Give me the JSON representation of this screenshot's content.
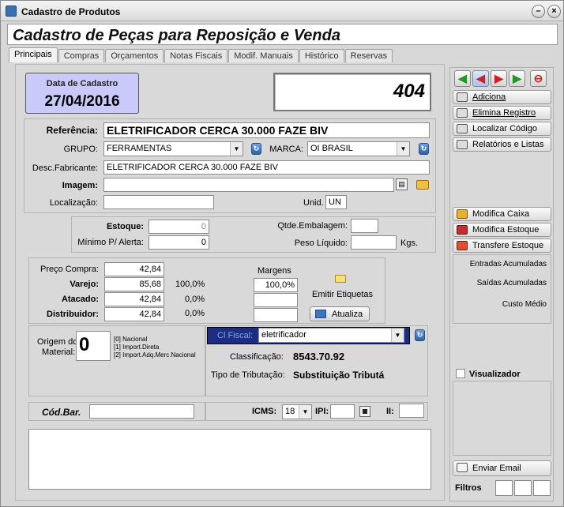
{
  "window": {
    "title": "Cadastro de Produtos"
  },
  "header": {
    "title": "Cadastro de Peças para Reposição e Venda"
  },
  "tabs": [
    "Principais",
    "Compras",
    "Orçamentos",
    "Notas Fiscais",
    "Modif. Manuais",
    "Histórico",
    "Reservas"
  ],
  "data_cadastro": {
    "label": "Data de Cadastro",
    "value": "27/04/2016"
  },
  "codigo": "404",
  "produto": {
    "referencia_label": "Referência:",
    "referencia": "ELETRIFICADOR CERCA 30.000 FAZE BIV",
    "grupo_label": "GRUPO:",
    "grupo": "FERRAMENTAS",
    "marca_label": "MARCA:",
    "marca": "OI BRASIL",
    "desc_label": "Desc.Fabricante:",
    "desc": "ELETRIFICADOR CERCA 30.000 FAZE BIV",
    "imagem_label": "Imagem:",
    "imagem": "",
    "localizacao_label": "Localização:",
    "localizacao": "",
    "unid_label": "Unid.",
    "unid": "UN"
  },
  "estoque": {
    "estoque_label": "Estoque:",
    "estoque": "0",
    "minimo_label": "Mínimo P/ Alerta:",
    "minimo": "0",
    "qtde_label": "Qtde.Embalagem:",
    "qtde": "",
    "peso_label": "Peso Líquido:",
    "peso": "",
    "peso_unit": "Kgs."
  },
  "precos": {
    "compra_label": "Preço Compra:",
    "compra": "42,84",
    "varejo_label": "Varejo:",
    "varejo": "85,68",
    "varejo_pct": "100,0%",
    "atacado_label": "Atacado:",
    "atacado": "42,84",
    "atacado_pct": "0,0%",
    "distrib_label": "Distribuidor:",
    "distrib": "42,84",
    "distrib_pct": "0,0%",
    "margens_label": "Margens",
    "margem1": "100,0%",
    "etiquetas_label": "Emitir Etiquetas",
    "atualiza_label": "Atualiza"
  },
  "origem": {
    "label1": "Origem do",
    "label2": "Material:",
    "value": "0",
    "opt0": "[0] Nacional",
    "opt1": "[1] Import.Direta",
    "opt2": "[2] Import.Adq.Merc.Nacional"
  },
  "fiscal": {
    "label": "Cl Fiscal:",
    "value": "eletrificador",
    "class_label": "Classificação:",
    "class_value": "8543.70.92",
    "trib_label": "Tipo de Tributação:",
    "trib_value": "Substituição Tributá"
  },
  "codbar": {
    "label": "Cód.Bar.",
    "value": ""
  },
  "impostos": {
    "icms_label": "ICMS:",
    "icms": "18",
    "ipi_label": "IPI:",
    "ipi": "",
    "ii_label": "II:",
    "ii": ""
  },
  "side": {
    "adiciona": "Adiciona",
    "elimina": "Elimina Registro",
    "localizar": "Localizar Código",
    "relatorios": "Relatórios e Listas",
    "modifica_caixa": "Modifica Caixa",
    "modifica_estoque": "Modifica Estoque",
    "transfere": "Transfere Estoque",
    "entradas": "Entradas Acumuladas",
    "saidas": "Saídas Acumuladas",
    "custo": "Custo Médio",
    "visualizador": "Visualizador",
    "enviar_email": "Enviar Email",
    "filtros": "Filtros"
  },
  "colors": {
    "date_box": "#c9c9fa",
    "fiscal_label_bg": "#1c2d86",
    "green_arrow": "#1f9a1f",
    "red_arrow": "#d22020"
  }
}
